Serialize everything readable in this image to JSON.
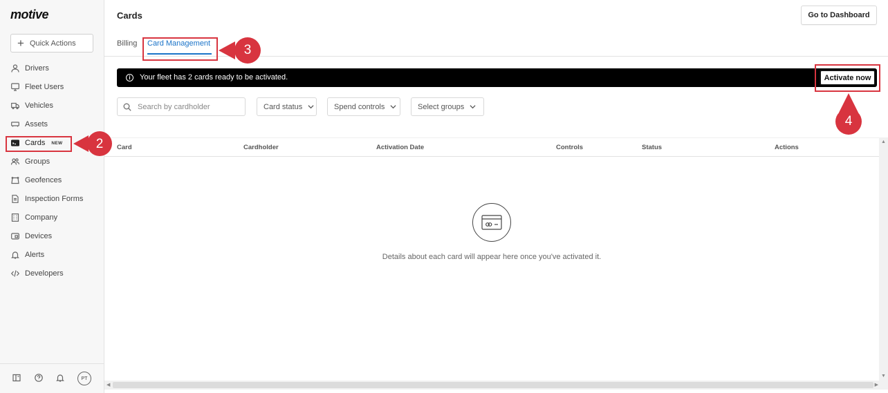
{
  "app": {
    "logo": "motive"
  },
  "sidebar": {
    "quick_actions": "Quick Actions",
    "items": [
      {
        "label": "Drivers",
        "icon": "user-icon"
      },
      {
        "label": "Fleet Users",
        "icon": "monitor-icon"
      },
      {
        "label": "Vehicles",
        "icon": "truck-icon"
      },
      {
        "label": "Assets",
        "icon": "trailer-icon"
      },
      {
        "label": "Cards",
        "icon": "card-icon",
        "badge": "NEW"
      },
      {
        "label": "Groups",
        "icon": "users-icon"
      },
      {
        "label": "Geofences",
        "icon": "geofence-icon"
      },
      {
        "label": "Inspection Forms",
        "icon": "document-icon"
      },
      {
        "label": "Company",
        "icon": "building-icon"
      },
      {
        "label": "Devices",
        "icon": "device-icon"
      },
      {
        "label": "Alerts",
        "icon": "bell-icon"
      },
      {
        "label": "Developers",
        "icon": "code-icon"
      }
    ],
    "footer": {
      "avatar_initials": "PT"
    }
  },
  "header": {
    "title": "Cards",
    "go_to_dashboard": "Go to Dashboard",
    "tabs": [
      {
        "label": "Billing",
        "active": false
      },
      {
        "label": "Card Management",
        "active": true
      }
    ]
  },
  "banner": {
    "message": "Your fleet has 2 cards ready to be activated.",
    "action": "Activate now"
  },
  "filters": {
    "search_placeholder": "Search by cardholder",
    "dropdowns": [
      "Card status",
      "Spend controls",
      "Select groups"
    ]
  },
  "table": {
    "columns": [
      "Card",
      "Cardholder",
      "Activation Date",
      "Controls",
      "Status",
      "Actions"
    ],
    "rows": [],
    "empty_message": "Details about each card will appear here once you've activated it."
  },
  "annotations": [
    "2",
    "3",
    "4"
  ],
  "colors": {
    "accent": "#1a73c8",
    "annotation": "#d8343f",
    "banner": "#000000"
  }
}
